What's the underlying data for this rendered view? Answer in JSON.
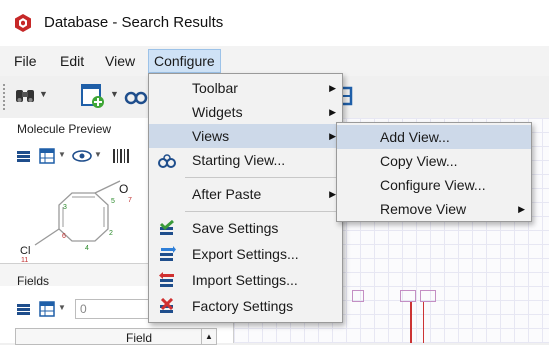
{
  "window": {
    "title": "Database - Search Results"
  },
  "menubar": {
    "items": [
      "File",
      "Edit",
      "View",
      "Configure"
    ]
  },
  "panels": {
    "molecule_preview": {
      "title": "Molecule Preview"
    },
    "fields": {
      "title": "Fields",
      "spin_value": "0",
      "column_header": "Field"
    },
    "structure_labels": {
      "oxygen": "O",
      "chlorine": "Cl",
      "atom_7": "7",
      "atom_6": "6",
      "atom_5": "5",
      "atom_4": "4",
      "atom_3": "3",
      "atom_2": "2",
      "atom_11": "11"
    }
  },
  "configure_menu": {
    "items": [
      {
        "label": "Toolbar",
        "submenu": true
      },
      {
        "label": "Widgets",
        "submenu": true
      },
      {
        "label": "Views",
        "submenu": true,
        "highlighted": true
      },
      {
        "label": "Starting View...",
        "submenu": false
      },
      {
        "label": "After Paste",
        "submenu": true
      },
      {
        "label": "Save Settings",
        "submenu": false
      },
      {
        "label": "Export Settings...",
        "submenu": false
      },
      {
        "label": "Import Settings...",
        "submenu": false
      },
      {
        "label": "Factory Settings",
        "submenu": false
      }
    ]
  },
  "views_submenu": {
    "items": [
      {
        "label": "Add View...",
        "highlighted": true
      },
      {
        "label": "Copy View..."
      },
      {
        "label": "Configure View..."
      },
      {
        "label": "Remove View",
        "submenu": true
      }
    ]
  },
  "icons": [
    "app-logo-icon",
    "binoculars-icon",
    "add-form-icon",
    "eye-icon",
    "grid-icon",
    "barcode-icon",
    "view-glasses-icon",
    "save-settings-icon",
    "export-settings-icon",
    "import-settings-icon",
    "factory-settings-icon",
    "chevron-right-icon",
    "chevron-down-icon"
  ],
  "colors": {
    "menu_highlight": "#cdd9e9",
    "menu_background": "#f2f2f2",
    "logo_red": "#c62828"
  }
}
